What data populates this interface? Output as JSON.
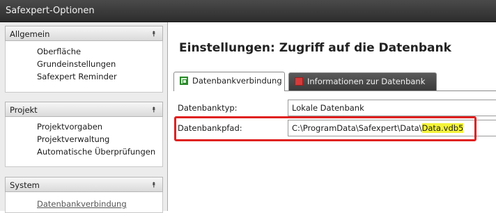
{
  "window": {
    "title": "Safexpert-Optionen"
  },
  "sidebar": {
    "sections": [
      {
        "title": "Allgemein",
        "items": [
          "Oberfläche",
          "Grundeinstellungen",
          "Safexpert Reminder"
        ]
      },
      {
        "title": "Projekt",
        "items": [
          "Projektvorgaben",
          "Projektverwaltung",
          "Automatische Überprüfungen"
        ]
      },
      {
        "title": "System",
        "items": [
          "Datenbankverbindung"
        ]
      }
    ]
  },
  "main": {
    "heading": "Einstellungen: Zugriff auf die Datenbank",
    "tabs": [
      {
        "label": "Datenbankverbindung",
        "active": true,
        "icon": "database-green-icon"
      },
      {
        "label": "Informationen zur Datenbank",
        "active": false,
        "icon": "database-red-icon"
      }
    ],
    "fields": {
      "type_label": "Datenbanktyp:",
      "type_value": "Lokale Datenbank",
      "path_label": "Datenbankpfad:",
      "path_prefix": "C:\\ProgramData\\Safexpert\\Data\\",
      "path_file": "Data.vdb5"
    }
  },
  "colors": {
    "highlight": "#f4f43a",
    "annotation_frame": "#e02020"
  },
  "icons": {
    "collapse": "chevron-double-up-icon"
  }
}
